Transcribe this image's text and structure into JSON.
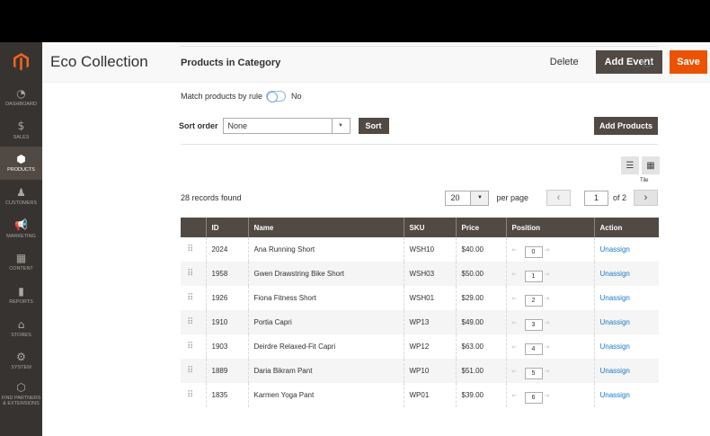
{
  "sidebar": {
    "items": [
      {
        "label": "DASHBOARD",
        "icon": "dashboard-icon",
        "glyph": "◔"
      },
      {
        "label": "SALES",
        "icon": "dollar-icon",
        "glyph": "$"
      },
      {
        "label": "PRODUCTS",
        "icon": "cube-icon",
        "glyph": "⬢"
      },
      {
        "label": "CUSTOMERS",
        "icon": "person-icon",
        "glyph": "♟"
      },
      {
        "label": "MARKETING",
        "icon": "megaphone-icon",
        "glyph": "📢"
      },
      {
        "label": "CONTENT",
        "icon": "layout-icon",
        "glyph": "▦"
      },
      {
        "label": "REPORTS",
        "icon": "bar-chart-icon",
        "glyph": "▮"
      },
      {
        "label": "STORES",
        "icon": "storefront-icon",
        "glyph": "⌂"
      },
      {
        "label": "SYSTEM",
        "icon": "gear-icon",
        "glyph": "⚙"
      },
      {
        "label": "FIND PARTNERS & EXTENSIONS",
        "icon": "puzzle-icon",
        "glyph": "⬡"
      }
    ]
  },
  "header": {
    "title": "Eco Collection",
    "delete_label": "Delete",
    "add_event_label": "Add Event",
    "save_label": "Save"
  },
  "section": {
    "title": "Products in Category",
    "match_label": "Match products by rule",
    "match_value": "No",
    "sort_order_label": "Sort order",
    "sort_order_value": "None",
    "sort_button": "Sort",
    "add_products_button": "Add Products",
    "tooltip": "Tile"
  },
  "grid": {
    "records_found": "28 records found",
    "per_page_value": "20",
    "per_page_label": "per page",
    "page_value": "1",
    "page_of": "of 2",
    "columns": [
      "ID",
      "Name",
      "SKU",
      "Price",
      "Position",
      "Action"
    ],
    "rows": [
      {
        "id": "2024",
        "name": "Ana Running Short",
        "sku": "WSH10",
        "price": "$40.00",
        "position": "0",
        "action": "Unassign"
      },
      {
        "id": "1958",
        "name": "Gwen Drawstring Bike Short",
        "sku": "WSH03",
        "price": "$50.00",
        "position": "1",
        "action": "Unassign"
      },
      {
        "id": "1926",
        "name": "Fiona Fitness Short",
        "sku": "WSH01",
        "price": "$29.00",
        "position": "2",
        "action": "Unassign"
      },
      {
        "id": "1910",
        "name": "Portia Capri",
        "sku": "WP13",
        "price": "$49.00",
        "position": "3",
        "action": "Unassign"
      },
      {
        "id": "1903",
        "name": "Deirdre Relaxed-Fit Capri",
        "sku": "WP12",
        "price": "$63.00",
        "position": "4",
        "action": "Unassign"
      },
      {
        "id": "1889",
        "name": "Daria Bikram Pant",
        "sku": "WP10",
        "price": "$51.00",
        "position": "5",
        "action": "Unassign"
      },
      {
        "id": "1835",
        "name": "Karmen Yoga Pant",
        "sku": "WP01",
        "price": "$39.00",
        "position": "6",
        "action": "Unassign"
      }
    ]
  },
  "colors": {
    "sidebar": "#373330",
    "header_dark": "#514943",
    "accent": "#eb5202",
    "link": "#1979c3"
  }
}
